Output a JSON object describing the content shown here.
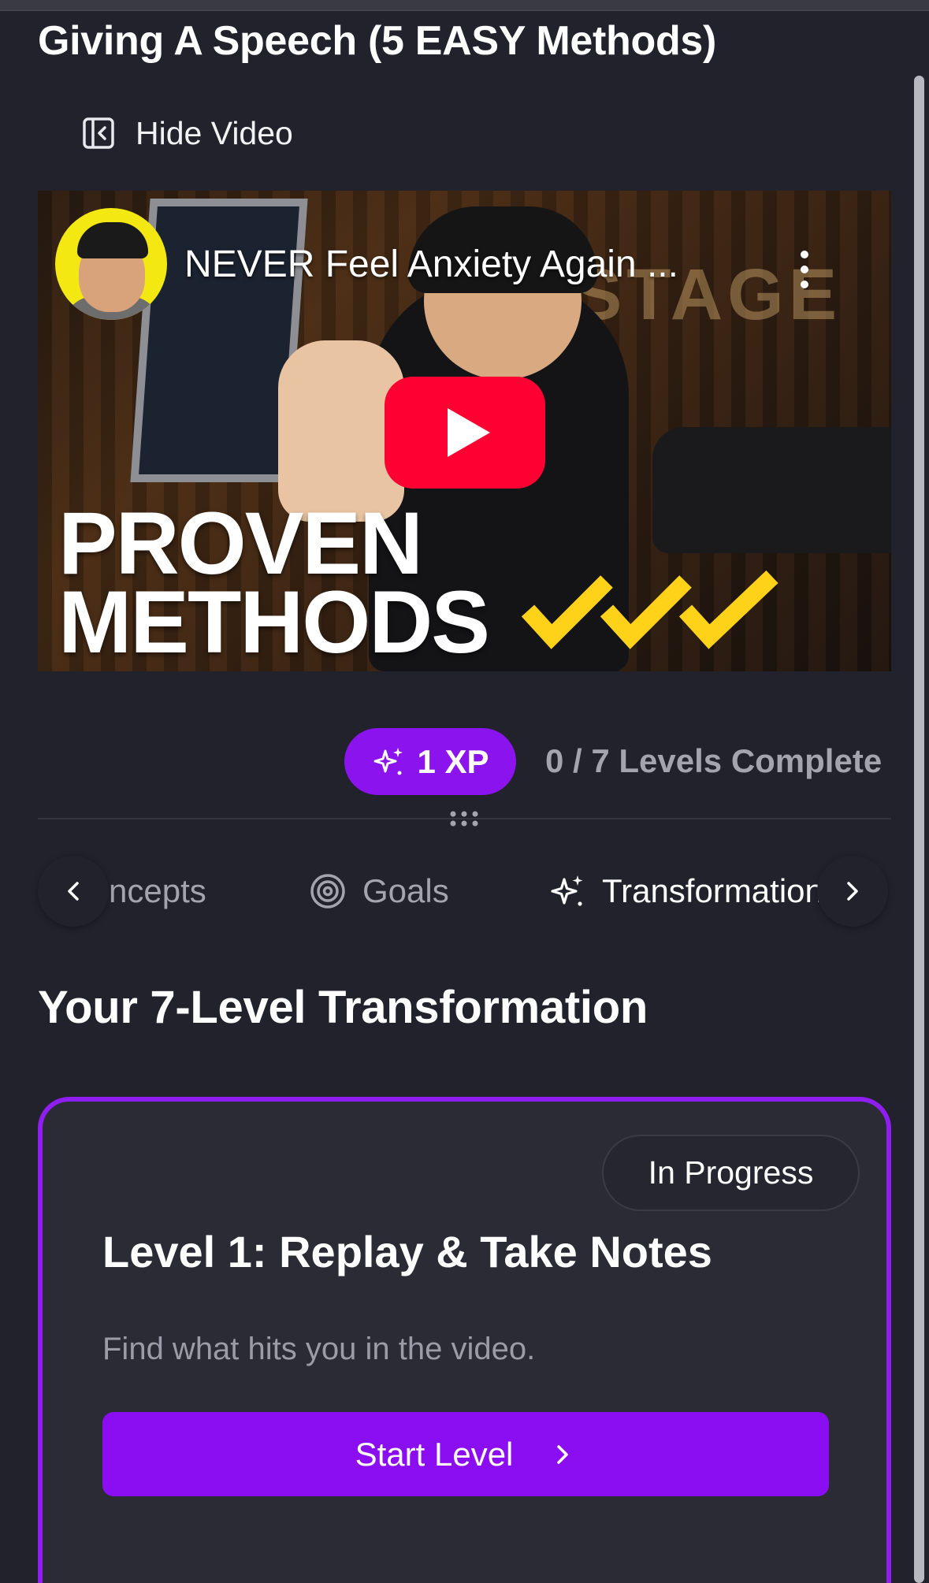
{
  "page": {
    "title": "Giving A Speech (5 EASY Methods)"
  },
  "hide_video": {
    "label": "Hide Video",
    "icon": "panel-collapse-icon"
  },
  "video": {
    "title": "NEVER Feel Anxiety Again ...",
    "overlay_line1": "PROVEN",
    "overlay_line2": "METHODS",
    "background_sign": "STAGE",
    "play_color": "#ff0033"
  },
  "progress": {
    "xp_label": "1 XP",
    "levels_complete": "0 / 7 Levels Complete",
    "accent": "#8b14ee"
  },
  "tabs": [
    {
      "label": "ncepts",
      "icon": "",
      "active": false
    },
    {
      "label": "Goals",
      "icon": "target-icon",
      "active": false
    },
    {
      "label": "Transformation",
      "icon": "sparkles-icon",
      "active": true
    }
  ],
  "section": {
    "title": "Your 7-Level Transformation"
  },
  "level": {
    "status": "In Progress",
    "title": "Level 1: Replay & Take Notes",
    "description": "Find what hits you in the video.",
    "button_label": "Start Level"
  }
}
